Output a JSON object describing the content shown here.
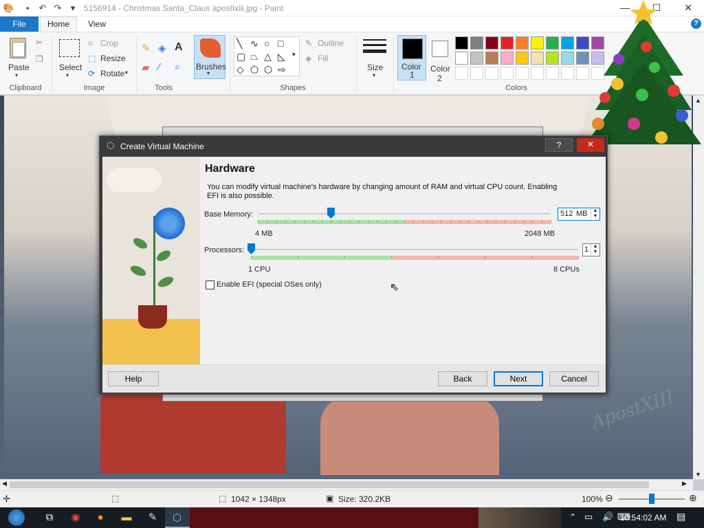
{
  "paint": {
    "window_title": "5156914 - Christmas Santa_Claus apostlxiii.jpg - Paint",
    "tabs": {
      "file": "File",
      "home": "Home",
      "view": "View"
    },
    "clipboard": {
      "paste": "Paste",
      "group": "Clipboard"
    },
    "image": {
      "select": "Select",
      "crop": "Crop",
      "resize": "Resize",
      "rotate": "Rotate",
      "group": "Image"
    },
    "tools": {
      "group": "Tools"
    },
    "brushes": "Brushes",
    "shapes": {
      "outline": "Outline",
      "fill": "Fill",
      "group": "Shapes"
    },
    "size": "Size",
    "color1": {
      "label": "Color",
      "num": "1"
    },
    "color2": {
      "label": "Color",
      "num": "2"
    },
    "colors_group": "Colors",
    "palette_row1": [
      "#000000",
      "#7f7f7f",
      "#880015",
      "#ed1c24",
      "#ff7f27",
      "#fff200",
      "#22b14c",
      "#00a2e8",
      "#3f48cc",
      "#a349a4"
    ],
    "palette_row2": [
      "#ffffff",
      "#c3c3c3",
      "#b97a57",
      "#ffaec9",
      "#ffc90e",
      "#efe4b0",
      "#b5e61d",
      "#99d9ea",
      "#7092be",
      "#c8bfe7"
    ],
    "status": {
      "dimensions": "1042 × 1348px",
      "size": "Size: 320.2KB",
      "zoom": "100%",
      "zoom_level": 1.0
    }
  },
  "dialog": {
    "title": "Create Virtual Machine",
    "help_glyph": "?",
    "close_glyph": "✕",
    "heading": "Hardware",
    "description": "You can modify virtual machine's hardware by changing amount of RAM and virtual CPU count. Enabling EFI is also possible.",
    "memory": {
      "label": "Base Memory:",
      "value": "512",
      "unit": "MB",
      "min_label": "4 MB",
      "max_label": "2048 MB",
      "min": 4,
      "max": 2048,
      "current": 512
    },
    "processors": {
      "label": "Processors:",
      "value": "1",
      "min_label": "1 CPU",
      "max_label": "8 CPUs",
      "min": 1,
      "max": 8,
      "current": 1
    },
    "efi": {
      "label": "Enable EFI (special OSes only)",
      "checked": false
    },
    "buttons": {
      "help": "Help",
      "back": "Back",
      "next": "Next",
      "cancel": "Cancel"
    }
  },
  "taskbar": {
    "time": "10:54:02 AM"
  }
}
